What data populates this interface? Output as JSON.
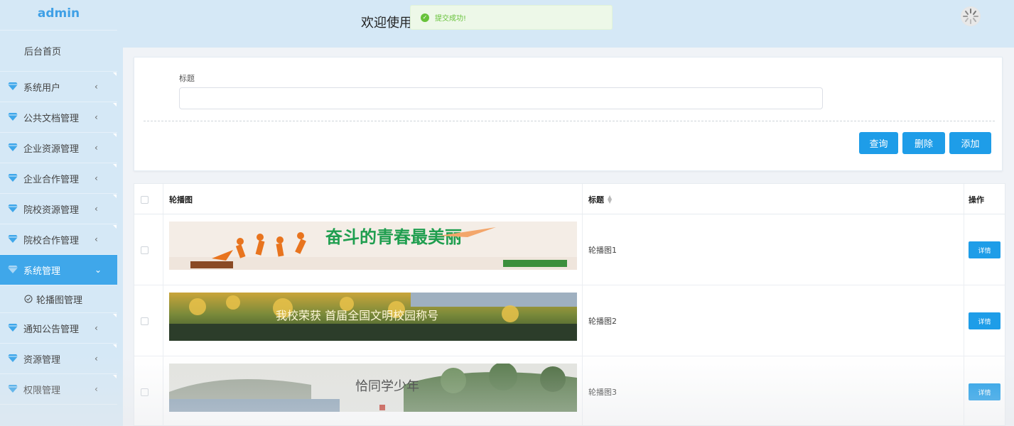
{
  "sidebar": {
    "logo": "admin",
    "home": "后台首页",
    "items": [
      {
        "label": "系统用户",
        "arrow": "‹",
        "icon": "gem-icon"
      },
      {
        "label": "公共文档管理",
        "arrow": "‹",
        "icon": "gem-icon"
      },
      {
        "label": "企业资源管理",
        "arrow": "‹",
        "icon": "gem-icon"
      },
      {
        "label": "企业合作管理",
        "arrow": "‹",
        "icon": "gem-icon"
      },
      {
        "label": "院校资源管理",
        "arrow": "‹",
        "icon": "gem-icon"
      },
      {
        "label": "院校合作管理",
        "arrow": "‹",
        "icon": "gem-icon"
      },
      {
        "label": "系统管理",
        "arrow": "⌄",
        "icon": "gem-icon",
        "active": true
      },
      {
        "label": "通知公告管理",
        "arrow": "‹",
        "icon": "gem-icon"
      },
      {
        "label": "资源管理",
        "arrow": "‹",
        "icon": "gem-icon"
      },
      {
        "label": "权限管理",
        "arrow": "‹",
        "icon": "gem-icon"
      }
    ],
    "submenu": {
      "label": "轮播图管理",
      "icon": "clock-icon"
    }
  },
  "header": {
    "welcome": "欢迎使用",
    "avatar": "avatar-icon"
  },
  "toast": {
    "text": "提交成功!",
    "icon": "check-circle-icon",
    "color": "#67c23a"
  },
  "search": {
    "label": "标题",
    "placeholder": "",
    "value": "",
    "buttons": {
      "query": "查询",
      "delete": "删除",
      "add": "添加"
    }
  },
  "table": {
    "headers": {
      "image": "轮播图",
      "title": "标题",
      "action": "操作"
    },
    "sort_icon": "sort-icon",
    "rows": [
      {
        "title": "轮播图1",
        "action": "详情",
        "banner_text": "奋斗的青春最美丽"
      },
      {
        "title": "轮播图2",
        "action": "详情",
        "banner_text": "我校荣获 首届全国文明校园称号"
      },
      {
        "title": "轮播图3",
        "action": "详情",
        "banner_text": "恰同学少年"
      }
    ]
  },
  "colors": {
    "accent": "#1e9de8",
    "sidebar_bg": "#d5e8f6",
    "active_bg": "#3fa7ea",
    "logo": "#3fa0e6"
  }
}
